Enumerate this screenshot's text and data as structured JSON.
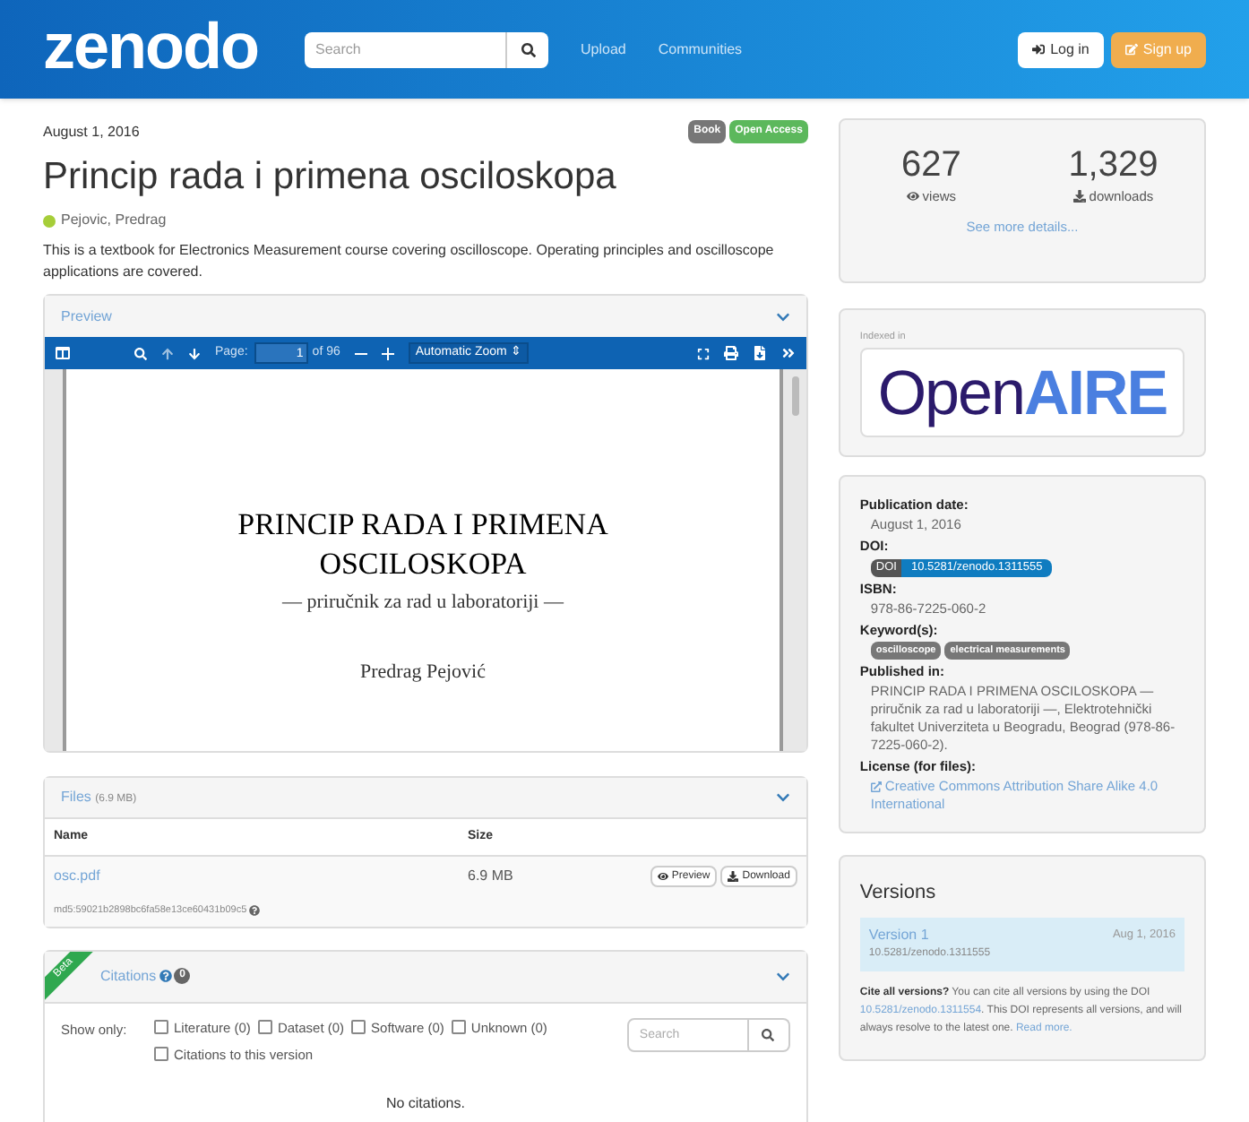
{
  "header": {
    "logo": "zenodo",
    "search": {
      "placeholder": "Search"
    },
    "nav": [
      "Upload",
      "Communities"
    ],
    "login": "Log in",
    "signup": "Sign up"
  },
  "record": {
    "date": "August 1, 2016",
    "badges": [
      {
        "label": "Book",
        "color": "#777777"
      },
      {
        "label": "Open Access",
        "color": "#5cb85c"
      }
    ],
    "title": "Princip rada i primena osciloskopa",
    "author": "Pejovic, Predrag",
    "description": "This is a textbook for Electronics Measurement course covering oscilloscope. Operating principles and oscilloscope applications are covered."
  },
  "preview": {
    "title": "Preview",
    "expanded": true,
    "toolbar": {
      "page_label": "Page:",
      "page": "1",
      "of": "of 96",
      "zoom": "Automatic Zoom",
      "zoom_arrow": "⇕"
    },
    "document": {
      "title_lines": [
        "PRINCIP RADA I PRIMENA",
        "OSCILOSKOPA"
      ],
      "subtitle": "— priručnik za rad u laboratoriji —",
      "author": "Predrag Pejović"
    }
  },
  "files": {
    "title": "Files",
    "size": "(6.9 MB)",
    "columns": [
      "Name",
      "Size"
    ],
    "rows": [
      {
        "name": "osc.pdf",
        "size": "6.9 MB",
        "preview": "Preview",
        "download": "Download",
        "checksum": "md5:59021b2898bc6fa58e13ce60431b09c5"
      }
    ]
  },
  "citations": {
    "ribbon": "Beta",
    "title": "Citations",
    "count": "0",
    "show_only": "Show only:",
    "filters": [
      {
        "label": "Literature (0)",
        "checked": false
      },
      {
        "label": "Dataset (0)",
        "checked": false
      },
      {
        "label": "Software (0)",
        "checked": false
      },
      {
        "label": "Unknown (0)",
        "checked": false
      },
      {
        "label": "Citations to this version",
        "checked": false
      }
    ],
    "search": {
      "placeholder": "Search"
    },
    "empty": "No citations."
  },
  "stats": {
    "views": "627",
    "views_label": "views",
    "downloads": "1,329",
    "downloads_label": "downloads",
    "details": "See more details..."
  },
  "indexed": {
    "label": "Indexed in",
    "logo_a": "Open",
    "logo_b": "AIRE"
  },
  "metadata": [
    {
      "label": "Publication date:",
      "kind": "text",
      "value": "August 1, 2016"
    },
    {
      "label": "DOI:",
      "kind": "doi",
      "prefix": "DOI",
      "value": "10.5281/zenodo.1311555"
    },
    {
      "label": "ISBN:",
      "kind": "text",
      "value": "978-86-7225-060-2"
    },
    {
      "label": "Keyword(s):",
      "kind": "tags",
      "tags": [
        "oscilloscope",
        "electrical measurements"
      ]
    },
    {
      "label": "Published in:",
      "kind": "text",
      "value": "PRINCIP RADA I PRIMENA OSCILOSKOPA — priručnik za rad u laboratoriji —, Elektrotehnički fakultet Univerziteta u Beogradu, Beograd (978-86-7225-060-2)."
    },
    {
      "label": "License (for files):",
      "kind": "link",
      "value": "Creative Commons Attribution Share Alike 4.0 International"
    }
  ],
  "versions": {
    "title": "Versions",
    "items": [
      {
        "name": "Version 1",
        "doi": "10.5281/zenodo.1311555",
        "date": "Aug 1, 2016",
        "selected": true
      }
    ],
    "cite": {
      "lead": "Cite all versions?",
      "text1": " You can cite all versions by using the DOI ",
      "doi": "10.5281/zenodo.1311554",
      "text2": ". This DOI represents all versions, and will always resolve to the latest one. ",
      "more": "Read more."
    }
  }
}
